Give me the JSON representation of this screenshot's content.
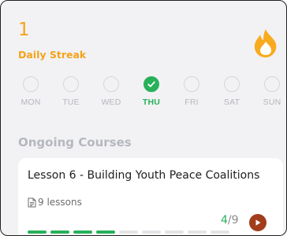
{
  "streak": {
    "count": "1",
    "label": "Daily Streak",
    "accent_color": "#f5a21b",
    "icon": "flame-icon"
  },
  "week": {
    "days": [
      {
        "label": "MON",
        "completed": false,
        "today": false
      },
      {
        "label": "TUE",
        "completed": false,
        "today": false
      },
      {
        "label": "WED",
        "completed": false,
        "today": false
      },
      {
        "label": "THU",
        "completed": true,
        "today": true
      },
      {
        "label": "FRI",
        "completed": false,
        "today": false
      },
      {
        "label": "SAT",
        "completed": false,
        "today": false
      },
      {
        "label": "SUN",
        "completed": false,
        "today": false
      }
    ],
    "complete_color": "#27b15a"
  },
  "courses": {
    "section_title": "Ongoing Courses",
    "items": [
      {
        "title": "Lesson 6 - Building Youth Peace Coalitions",
        "lessons_text": "9 lessons",
        "completed": "4",
        "total": "9",
        "total_display": "/9",
        "play_color": "#a13d1b"
      }
    ]
  }
}
